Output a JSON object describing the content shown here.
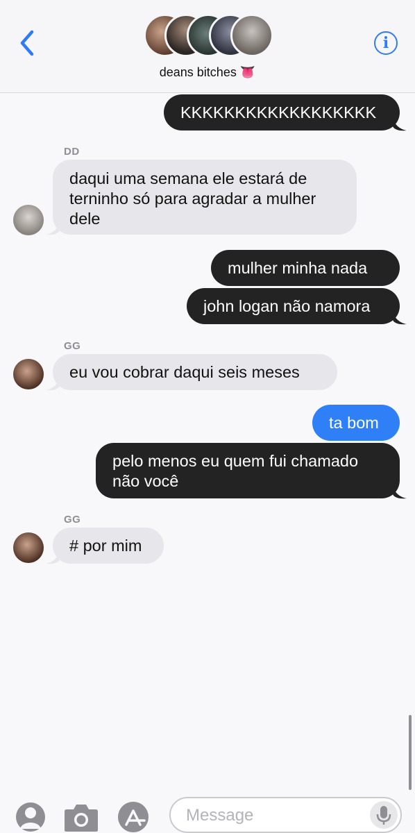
{
  "header": {
    "group_name": "deans bitches 👅"
  },
  "messages": {
    "m1": "KKKKKKKKKKKKKKKKKK",
    "dd_sender": "DD",
    "m2_l1": "daqui uma semana ele estará de",
    "m2_l2": "terninho só para agradar a mulher",
    "m2_l3": "dele",
    "m3": "mulher minha nada",
    "m4": "john logan não namora",
    "gg_sender_1": "GG",
    "m5": "eu vou cobrar daqui seis meses",
    "m6": "ta bom",
    "m7_l1": "pelo menos eu quem fui chamado",
    "m7_l2": "não você",
    "gg_sender_2": "GG",
    "m8": "# por mim"
  },
  "composer": {
    "placeholder": "Message"
  },
  "colors": {
    "sent_dark": "#232323",
    "sent_blue": "#2f80f6",
    "received": "#e6e6eb",
    "accent": "#2f7bf5"
  },
  "icons": [
    "back-chevron-icon",
    "info-icon",
    "contact-icon",
    "camera-icon",
    "app-store-icon",
    "microphone-icon"
  ]
}
